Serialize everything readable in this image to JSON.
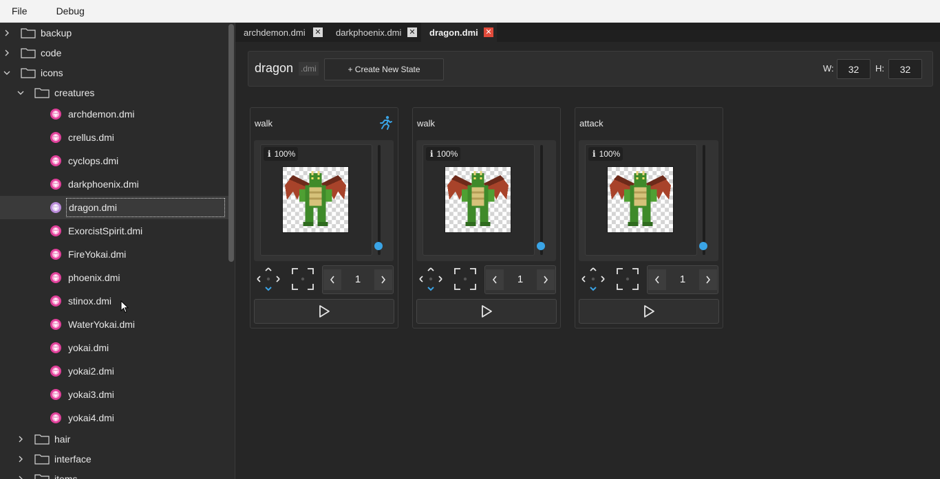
{
  "menu": {
    "file": "File",
    "debug": "Debug"
  },
  "sidebar": {
    "top_folders": [
      {
        "label": "backup",
        "expanded": false
      },
      {
        "label": "code",
        "expanded": false
      },
      {
        "label": "icons",
        "expanded": true
      }
    ],
    "subfolder": {
      "label": "creatures",
      "expanded": true
    },
    "files": [
      "archdemon.dmi",
      "crellus.dmi",
      "cyclops.dmi",
      "darkphoenix.dmi",
      "dragon.dmi",
      "ExorcistSpirit.dmi",
      "FireYokai.dmi",
      "phoenix.dmi",
      "stinox.dmi",
      "WaterYokai.dmi",
      "yokai.dmi",
      "yokai2.dmi",
      "yokai3.dmi",
      "yokai4.dmi"
    ],
    "selected_file": "dragon.dmi",
    "bottom_folders": [
      {
        "label": "hair",
        "expanded": false
      },
      {
        "label": "interface",
        "expanded": false
      },
      {
        "label": "items",
        "expanded": false
      }
    ]
  },
  "tabs": [
    {
      "label": "archdemon.dmi",
      "active": false
    },
    {
      "label": "darkphoenix.dmi",
      "active": false
    },
    {
      "label": "dragon.dmi",
      "active": true
    }
  ],
  "editor": {
    "doc_name": "dragon",
    "doc_ext": ".dmi",
    "create_state_label": "+ Create New State",
    "width_label": "W:",
    "width_value": "32",
    "height_label": "H:",
    "height_value": "32"
  },
  "states": [
    {
      "name": "walk",
      "zoom": "100%",
      "frame": "1",
      "has_movement_icon": true
    },
    {
      "name": "walk",
      "zoom": "100%",
      "frame": "1",
      "has_movement_icon": false
    },
    {
      "name": "attack",
      "zoom": "100%",
      "frame": "1",
      "has_movement_icon": false
    }
  ],
  "colors": {
    "accent": "#3aa4e6",
    "close_active": "#e14b3b",
    "gem": "#e0409a"
  }
}
